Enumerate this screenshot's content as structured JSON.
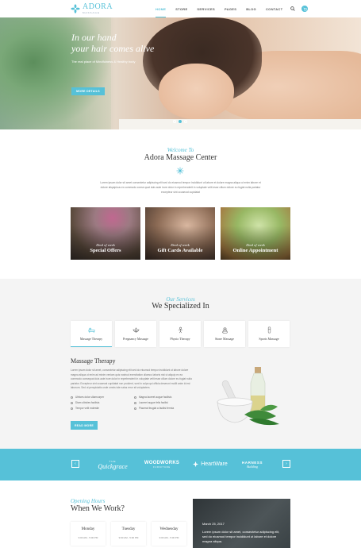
{
  "brand": {
    "name": "ADORA",
    "tagline": "MASSAGE",
    "accent_color": "#56c1d8"
  },
  "nav": {
    "items": [
      "HOME",
      "STORE",
      "SERVICES",
      "PAGES",
      "BLOG",
      "CONTACT"
    ],
    "active": "HOME",
    "search_icon": "search-icon",
    "cart_icon": "cart-icon"
  },
  "hero": {
    "headline_line1": "In our hand",
    "headline_line2": "your hair comes alive",
    "subline": "The real place of Mindfulness & Healthy body",
    "button": "MORE DETAILS",
    "slides": 3,
    "active_slide": 2
  },
  "welcome": {
    "kicker": "Welcome To",
    "title": "Adora Massage Center",
    "icon": "flower-icon",
    "text": "Lorem ipsum dolor sit amet consectetur adipiscing elit sed do eiusmod tempor incididunt ut labore et dolore magna aliqua ut enim labore et dolore aliquipicus ex commodo conse quat duis aute irure dolor in reprehenderit in voluptate velit esse cillum dolore eu fugiat nulla pariatur excepteur sint occaecat cupidatat"
  },
  "cards": [
    {
      "kicker": "Deal of week",
      "title": "Special Offers"
    },
    {
      "kicker": "Deal of week",
      "title": "Gift Cards Available"
    },
    {
      "kicker": "Deal of week",
      "title": "Online Appointment"
    }
  ],
  "services": {
    "kicker": "Our Services",
    "title": "We Specialized In",
    "tabs": [
      {
        "label": "Massage Therapy",
        "icon": "massage-icon"
      },
      {
        "label": "Pregnancy Massage",
        "icon": "lotus-icon"
      },
      {
        "label": "Physio Therapy",
        "icon": "physio-icon"
      },
      {
        "label": "Stone Massage",
        "icon": "stones-icon"
      },
      {
        "label": "Sports Massage",
        "icon": "sports-icon"
      }
    ],
    "active_tab": "Massage Therapy",
    "detail_title": "Massage Therapy",
    "detail_text": "Lorem ipsum dolor sit amet, consectetur adipiscing elit sed do eiusmod tempor incididunt ut labore dolore magna aliqua ut enim ad minim veniam quis nostrud exercitation ullamco laboris nisi ut aliquip ex ea commodo consequat duis aute irure dolor in reprehenderit in voluptate velit esse cillum dolore eu fugiat nulla pariatur. Excepteur sint occaecat cupidatat non proident, sunt in culpa qui officia deserunt mollit anim id est laborum. Sed ut perspiciatis unde omnis iste natus error sit voluptatem.",
    "list": [
      "Ultrices dolor ullamcorper",
      "Magna laoreet augue facilisis",
      "Diam ultricies facilisis",
      "Laoreet augue felis facilisi",
      "Tempor velit molestie",
      "Placerat feugiat a facilisi fermia"
    ],
    "button": "READ MORE"
  },
  "partners": {
    "prev_icon": "chevron-left-icon",
    "next_icon": "chevron-right-icon",
    "logos": [
      {
        "pre": "THE",
        "name": "Quickgrace"
      },
      {
        "name": "WOODWORKS",
        "sub": "FURNITURE"
      },
      {
        "name": "HeartWare"
      },
      {
        "name": "HARNESS",
        "sub": "Building"
      }
    ]
  },
  "hours": {
    "kicker": "Opening Hours",
    "title": "When We Work?",
    "days": [
      {
        "name": "Monday",
        "time": "9:00 AM - 5:00 PM"
      },
      {
        "name": "Tuesday",
        "time": "9:00 AM - 5:00 PM"
      },
      {
        "name": "Wednesday",
        "time": "9:00 AM - 5:00 PM"
      }
    ]
  },
  "news": {
    "date": "March 25, 2017",
    "text": "Lorem ipsum dolor sit amet, consectetur adipiscing elit, sed do eiusmod tempor incididunt ut labore et dolore magna aliqua."
  }
}
